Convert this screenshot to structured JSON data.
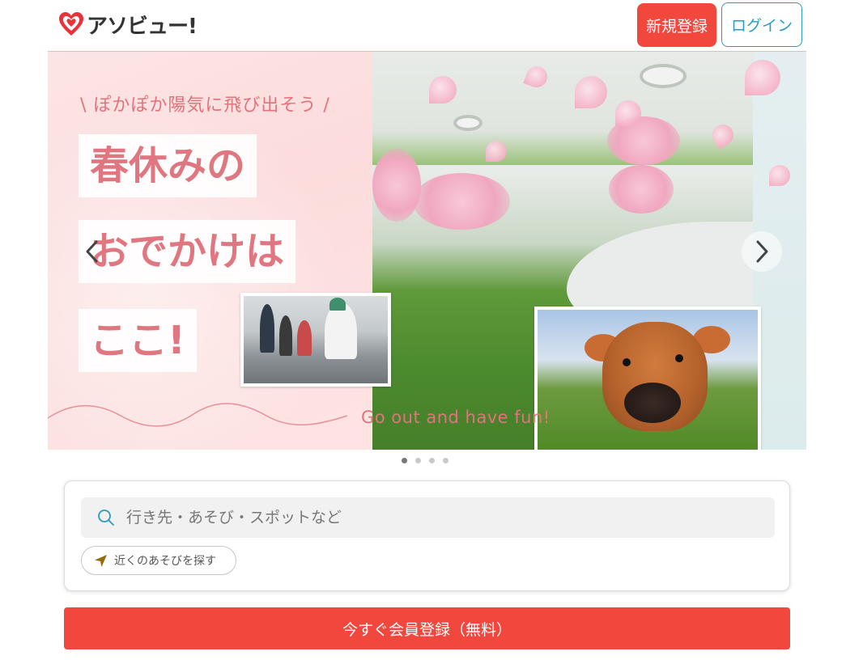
{
  "header": {
    "logo_text": "アソビュー!",
    "register_label": "新規登録",
    "login_label": "ログイン"
  },
  "banner": {
    "tagline": "\\ ぽかぽか陽気に飛び出そう /",
    "headline_line1": "春休みの",
    "headline_line2": "おでかけは",
    "headline_line3": "ここ!",
    "subline": "Go out and have fun!",
    "slide_count": 4,
    "active_slide": 1
  },
  "search": {
    "placeholder": "行き先・あそび・スポットなど",
    "nearby_label": "近くのあそびを探す"
  },
  "cta": {
    "label": "今すぐ会員登録（無料）"
  },
  "colors": {
    "brand_red": "#f2473d",
    "login_blue": "#2a9bbf",
    "banner_pink_text": "#e0737b"
  },
  "icons": {
    "logo": "heart-logo-icon",
    "prev": "chevron-left-icon",
    "next": "chevron-right-icon",
    "search": "search-icon",
    "nearby": "location-arrow-icon"
  }
}
